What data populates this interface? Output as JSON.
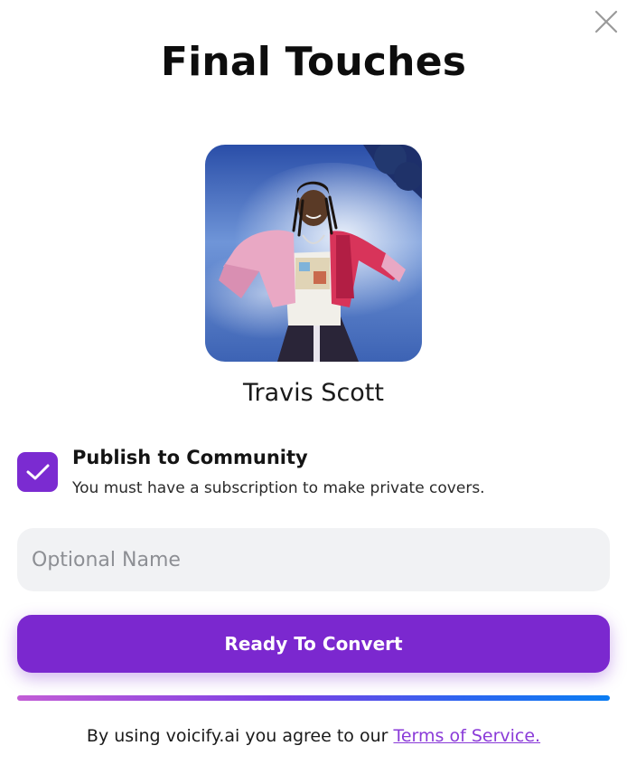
{
  "dialog": {
    "title": "Final Touches",
    "close_icon": "close-icon"
  },
  "artist": {
    "name": "Travis Scott",
    "image_alt": "artist photo"
  },
  "publish": {
    "checked": true,
    "label": "Publish to Community",
    "subtext": "You must have a subscription to make private covers.",
    "check_icon": "checkmark-icon"
  },
  "name_input": {
    "value": "",
    "placeholder": "Optional Name"
  },
  "convert_button": {
    "label": "Ready To Convert"
  },
  "progress": {
    "value": 1.0
  },
  "footer": {
    "text": "By using voicify.ai you agree to our",
    "link_text": "Terms of Service."
  },
  "colors": {
    "accent": "#7b28cf",
    "input_bg": "#f1f2f4",
    "link": "#8a3ad8"
  }
}
